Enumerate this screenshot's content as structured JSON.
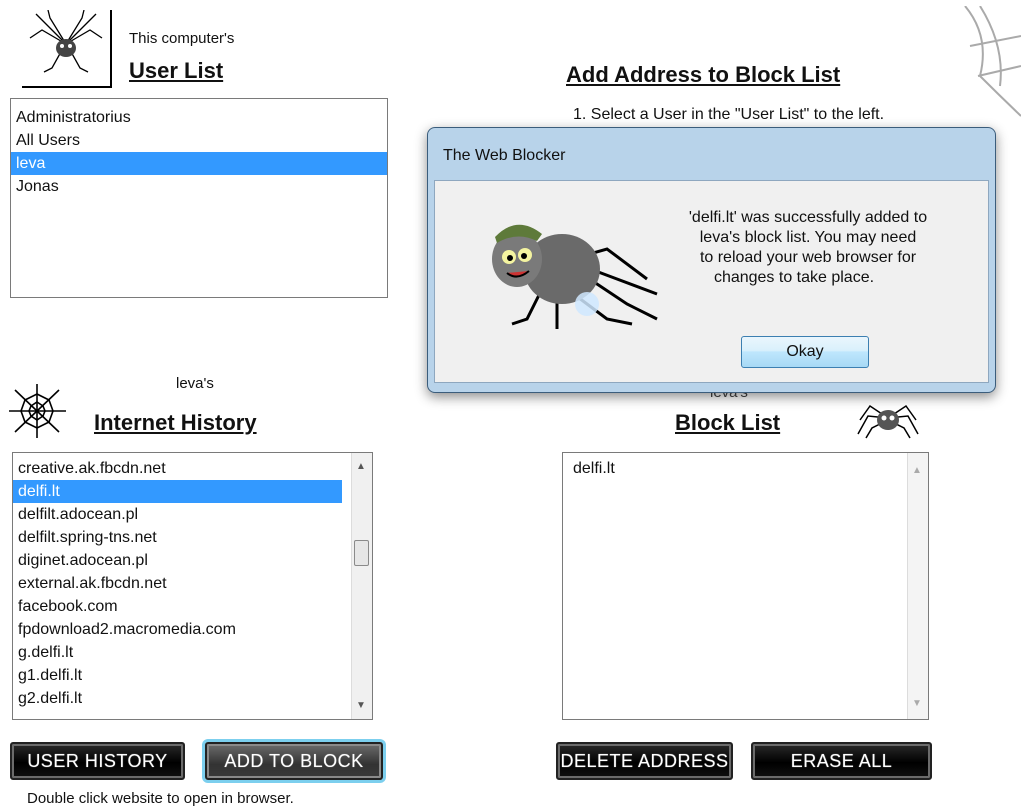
{
  "user_section": {
    "subtitle": "This computer's",
    "title": "User List",
    "users": [
      "Administratorius",
      "All Users",
      "leva",
      "Jonas"
    ],
    "selected_index": 2
  },
  "add_section": {
    "title": "Add Address to Block List",
    "instruction_1": "1. Select a User in the \"User List\" to the left."
  },
  "history_section": {
    "owner": "leva's",
    "title": "Internet History",
    "items": [
      "creative.ak.fbcdn.net",
      "delfi.lt",
      "delfilt.adocean.pl",
      "delfilt.spring-tns.net",
      "diginet.adocean.pl",
      "external.ak.fbcdn.net",
      "facebook.com",
      "fpdownload2.macromedia.com",
      "g.delfi.lt",
      "g1.delfi.lt",
      "g2.delfi.lt"
    ],
    "selected_index": 1,
    "user_history_button": "USER HISTORY",
    "add_to_block_button": "ADD TO BLOCK",
    "hint": "Double click website to open in browser."
  },
  "block_section": {
    "owner": "leva's",
    "title": "Block List",
    "items": [
      "delfi.lt"
    ],
    "delete_button": "DELETE ADDRESS",
    "erase_button": "ERASE ALL"
  },
  "dialog": {
    "title": "The Web Blocker",
    "message_line1": "'delfi.lt' was successfully added to",
    "message_line2": "leva's block list. You may need",
    "message_line3": "to reload your web browser for",
    "message_line4": "changes to take place.",
    "ok_button": "Okay"
  },
  "colors": {
    "selection": "#3399ff",
    "dialog_frame": "#b8d3ea"
  }
}
